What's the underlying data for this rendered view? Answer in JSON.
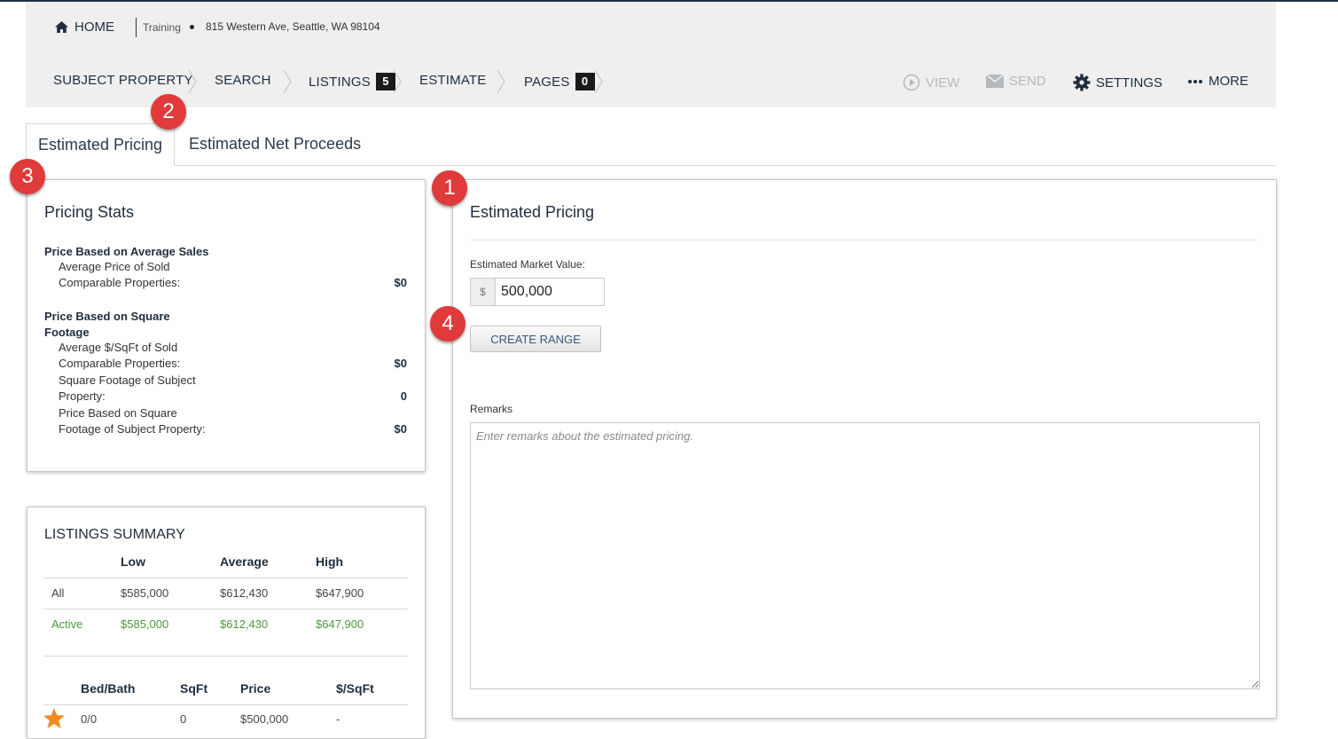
{
  "breadcrumb": {
    "home": "HOME",
    "training": "Training",
    "address": "815 Western Ave, Seattle, WA 98104"
  },
  "steps": [
    {
      "label": "SUBJECT PROPERTY"
    },
    {
      "label": "SEARCH"
    },
    {
      "label": "LISTINGS",
      "badge": "5"
    },
    {
      "label": "ESTIMATE"
    },
    {
      "label": "PAGES",
      "badge": "0"
    }
  ],
  "actions": {
    "view": "VIEW",
    "send": "SEND",
    "settings": "SETTINGS",
    "more": "MORE"
  },
  "tabs": {
    "estimated_pricing": "Estimated Pricing",
    "net_proceeds": "Estimated Net Proceeds"
  },
  "pricing_stats": {
    "title": "Pricing Stats",
    "avg_sales_head": "Price Based on Average Sales",
    "avg_sold_line1": "Average Price of Sold",
    "avg_sold_line2": "Comparable Properties:",
    "avg_sold_value": "$0",
    "sqft_head_line1": "Price Based on Square",
    "sqft_head_line2": "Footage",
    "avg_sqft_line1": "Average $/SqFt of Sold",
    "avg_sqft_line2": "Comparable Properties:",
    "avg_sqft_value": "$0",
    "subject_sqft_line1": "Square Footage of Subject",
    "subject_sqft_line2": "Property:",
    "subject_sqft_value": "0",
    "price_sqft_line1": "Price Based on Square",
    "price_sqft_line2": "Footage of Subject Property:",
    "price_sqft_value": "$0"
  },
  "listings_summary": {
    "title": "LISTINGS SUMMARY",
    "columns": [
      "Low",
      "Average",
      "High"
    ],
    "rows": [
      {
        "label": "All",
        "low": "$585,000",
        "avg": "$612,430",
        "high": "$647,900"
      },
      {
        "label": "Active",
        "low": "$585,000",
        "avg": "$612,430",
        "high": "$647,900"
      }
    ],
    "detail_columns": [
      "Bed/Bath",
      "SqFt",
      "Price",
      "$/SqFt"
    ],
    "detail_rows": [
      {
        "bedbath": "0/0",
        "sqft": "0",
        "price": "$500,000",
        "per_sqft": "-"
      }
    ]
  },
  "estimated_pricing": {
    "title": "Estimated Pricing",
    "market_value_label": "Estimated Market Value:",
    "currency_symbol": "$",
    "market_value": "500,000",
    "create_range": "CREATE RANGE",
    "remarks_label": "Remarks",
    "remarks_placeholder": "Enter remarks about the estimated pricing."
  },
  "callouts": [
    "1",
    "2",
    "3",
    "4"
  ],
  "colors": {
    "header_bg": "#efefef",
    "navy": "#1f2d3d",
    "active_green": "#4a9a3a",
    "callout_red": "#e03a3a",
    "star_orange": "#f08a1c"
  }
}
